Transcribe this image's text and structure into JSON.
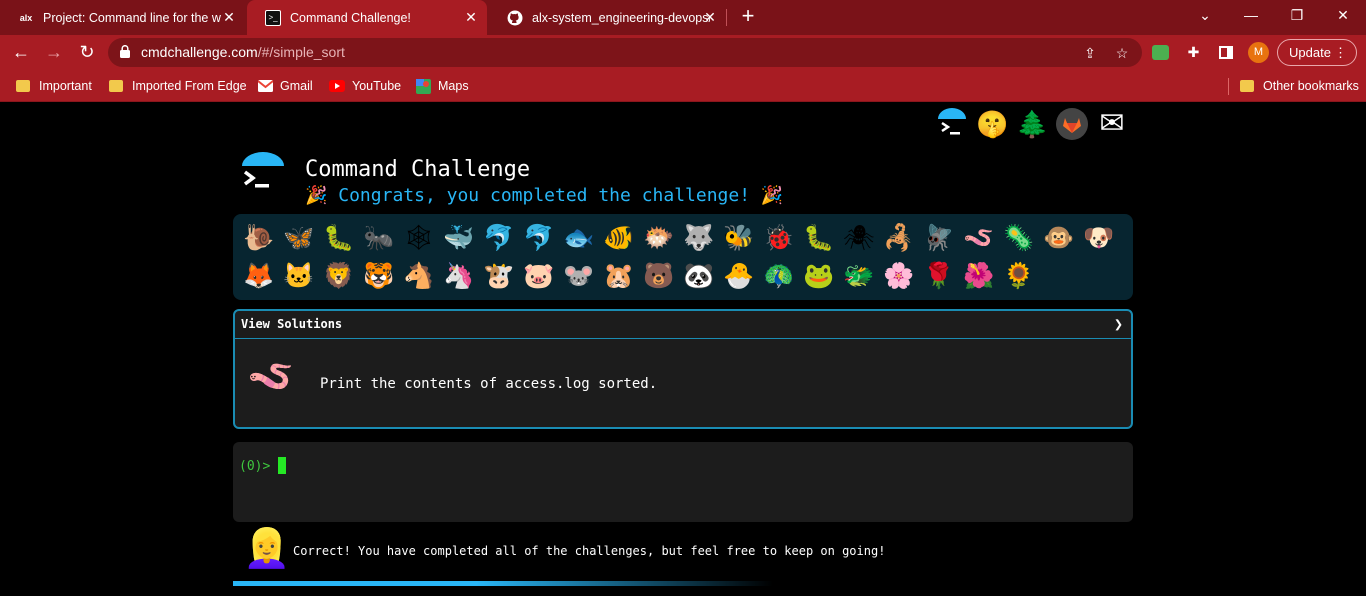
{
  "browser": {
    "tabs": [
      {
        "title": "Project: Command line for the wi",
        "favicon": "alx-logo-icon"
      },
      {
        "title": "Command Challenge!",
        "favicon": "terminal-icon",
        "active": true
      },
      {
        "title": "alx-system_engineering-devops/c",
        "favicon": "github-icon"
      }
    ],
    "url_host": "cmdchallenge.com",
    "url_path": "/#/simple_sort",
    "update_label": "Update",
    "avatar_letter": "M",
    "bookmarks": [
      "Important",
      "Imported From Edge",
      "Gmail",
      "YouTube",
      "Maps"
    ],
    "other_bookmarks": "Other bookmarks"
  },
  "header": {
    "title": "Command Challenge",
    "congrats_emoji_left": "🎉",
    "congrats_text": " Congrats, you completed the challenge! ",
    "congrats_emoji_right": "🎉",
    "top_icons": [
      "🤫",
      "🌲",
      "✉"
    ]
  },
  "animals": [
    "🐌",
    "🦋",
    "🐛",
    "🐜",
    "🕸",
    "🐳",
    "🐬",
    "🐬",
    "🐟",
    "🐠",
    "🐡",
    "🐺",
    "🐝",
    "🐞",
    "🐛",
    "🕷",
    "🦂",
    "🪰",
    "🪱",
    "🦠",
    "🐵",
    "🐶",
    "🦊",
    "🐱",
    "🦁",
    "🐯",
    "🐴",
    "🦄",
    "🐮",
    "🐷",
    "🐭",
    "🐹",
    "🐻",
    "🐼",
    "🐣",
    "🦚",
    "🐸",
    "🐲",
    "🌸",
    "🌹",
    "🌺",
    "🌻"
  ],
  "challenge": {
    "view_solutions": "View Solutions",
    "chevron": "❯",
    "worm": "🪱",
    "description": "Print the contents of access.log sorted."
  },
  "terminal": {
    "prompt": "(0)>"
  },
  "feedback": {
    "face": "👱‍♀️",
    "message": "Correct! You have completed all of the challenges, but feel free to keep on going!",
    "progress": 0.45
  },
  "colors": {
    "chrome_dark": "#7a1218",
    "chrome": "#a81c23",
    "accent": "#29b6f6",
    "prompt_green": "#3ec73e"
  }
}
